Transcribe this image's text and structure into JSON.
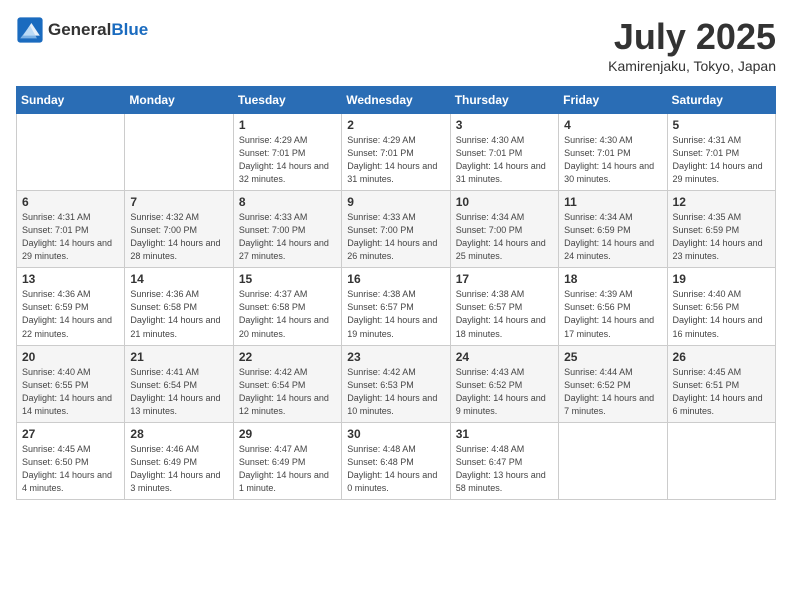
{
  "header": {
    "logo_general": "General",
    "logo_blue": "Blue",
    "month": "July 2025",
    "location": "Kamirenjaku, Tokyo, Japan"
  },
  "days_of_week": [
    "Sunday",
    "Monday",
    "Tuesday",
    "Wednesday",
    "Thursday",
    "Friday",
    "Saturday"
  ],
  "weeks": [
    [
      {
        "day": "",
        "info": ""
      },
      {
        "day": "",
        "info": ""
      },
      {
        "day": "1",
        "info": "Sunrise: 4:29 AM\nSunset: 7:01 PM\nDaylight: 14 hours and 32 minutes."
      },
      {
        "day": "2",
        "info": "Sunrise: 4:29 AM\nSunset: 7:01 PM\nDaylight: 14 hours and 31 minutes."
      },
      {
        "day": "3",
        "info": "Sunrise: 4:30 AM\nSunset: 7:01 PM\nDaylight: 14 hours and 31 minutes."
      },
      {
        "day": "4",
        "info": "Sunrise: 4:30 AM\nSunset: 7:01 PM\nDaylight: 14 hours and 30 minutes."
      },
      {
        "day": "5",
        "info": "Sunrise: 4:31 AM\nSunset: 7:01 PM\nDaylight: 14 hours and 29 minutes."
      }
    ],
    [
      {
        "day": "6",
        "info": "Sunrise: 4:31 AM\nSunset: 7:01 PM\nDaylight: 14 hours and 29 minutes."
      },
      {
        "day": "7",
        "info": "Sunrise: 4:32 AM\nSunset: 7:00 PM\nDaylight: 14 hours and 28 minutes."
      },
      {
        "day": "8",
        "info": "Sunrise: 4:33 AM\nSunset: 7:00 PM\nDaylight: 14 hours and 27 minutes."
      },
      {
        "day": "9",
        "info": "Sunrise: 4:33 AM\nSunset: 7:00 PM\nDaylight: 14 hours and 26 minutes."
      },
      {
        "day": "10",
        "info": "Sunrise: 4:34 AM\nSunset: 7:00 PM\nDaylight: 14 hours and 25 minutes."
      },
      {
        "day": "11",
        "info": "Sunrise: 4:34 AM\nSunset: 6:59 PM\nDaylight: 14 hours and 24 minutes."
      },
      {
        "day": "12",
        "info": "Sunrise: 4:35 AM\nSunset: 6:59 PM\nDaylight: 14 hours and 23 minutes."
      }
    ],
    [
      {
        "day": "13",
        "info": "Sunrise: 4:36 AM\nSunset: 6:59 PM\nDaylight: 14 hours and 22 minutes."
      },
      {
        "day": "14",
        "info": "Sunrise: 4:36 AM\nSunset: 6:58 PM\nDaylight: 14 hours and 21 minutes."
      },
      {
        "day": "15",
        "info": "Sunrise: 4:37 AM\nSunset: 6:58 PM\nDaylight: 14 hours and 20 minutes."
      },
      {
        "day": "16",
        "info": "Sunrise: 4:38 AM\nSunset: 6:57 PM\nDaylight: 14 hours and 19 minutes."
      },
      {
        "day": "17",
        "info": "Sunrise: 4:38 AM\nSunset: 6:57 PM\nDaylight: 14 hours and 18 minutes."
      },
      {
        "day": "18",
        "info": "Sunrise: 4:39 AM\nSunset: 6:56 PM\nDaylight: 14 hours and 17 minutes."
      },
      {
        "day": "19",
        "info": "Sunrise: 4:40 AM\nSunset: 6:56 PM\nDaylight: 14 hours and 16 minutes."
      }
    ],
    [
      {
        "day": "20",
        "info": "Sunrise: 4:40 AM\nSunset: 6:55 PM\nDaylight: 14 hours and 14 minutes."
      },
      {
        "day": "21",
        "info": "Sunrise: 4:41 AM\nSunset: 6:54 PM\nDaylight: 14 hours and 13 minutes."
      },
      {
        "day": "22",
        "info": "Sunrise: 4:42 AM\nSunset: 6:54 PM\nDaylight: 14 hours and 12 minutes."
      },
      {
        "day": "23",
        "info": "Sunrise: 4:42 AM\nSunset: 6:53 PM\nDaylight: 14 hours and 10 minutes."
      },
      {
        "day": "24",
        "info": "Sunrise: 4:43 AM\nSunset: 6:52 PM\nDaylight: 14 hours and 9 minutes."
      },
      {
        "day": "25",
        "info": "Sunrise: 4:44 AM\nSunset: 6:52 PM\nDaylight: 14 hours and 7 minutes."
      },
      {
        "day": "26",
        "info": "Sunrise: 4:45 AM\nSunset: 6:51 PM\nDaylight: 14 hours and 6 minutes."
      }
    ],
    [
      {
        "day": "27",
        "info": "Sunrise: 4:45 AM\nSunset: 6:50 PM\nDaylight: 14 hours and 4 minutes."
      },
      {
        "day": "28",
        "info": "Sunrise: 4:46 AM\nSunset: 6:49 PM\nDaylight: 14 hours and 3 minutes."
      },
      {
        "day": "29",
        "info": "Sunrise: 4:47 AM\nSunset: 6:49 PM\nDaylight: 14 hours and 1 minute."
      },
      {
        "day": "30",
        "info": "Sunrise: 4:48 AM\nSunset: 6:48 PM\nDaylight: 14 hours and 0 minutes."
      },
      {
        "day": "31",
        "info": "Sunrise: 4:48 AM\nSunset: 6:47 PM\nDaylight: 13 hours and 58 minutes."
      },
      {
        "day": "",
        "info": ""
      },
      {
        "day": "",
        "info": ""
      }
    ]
  ]
}
